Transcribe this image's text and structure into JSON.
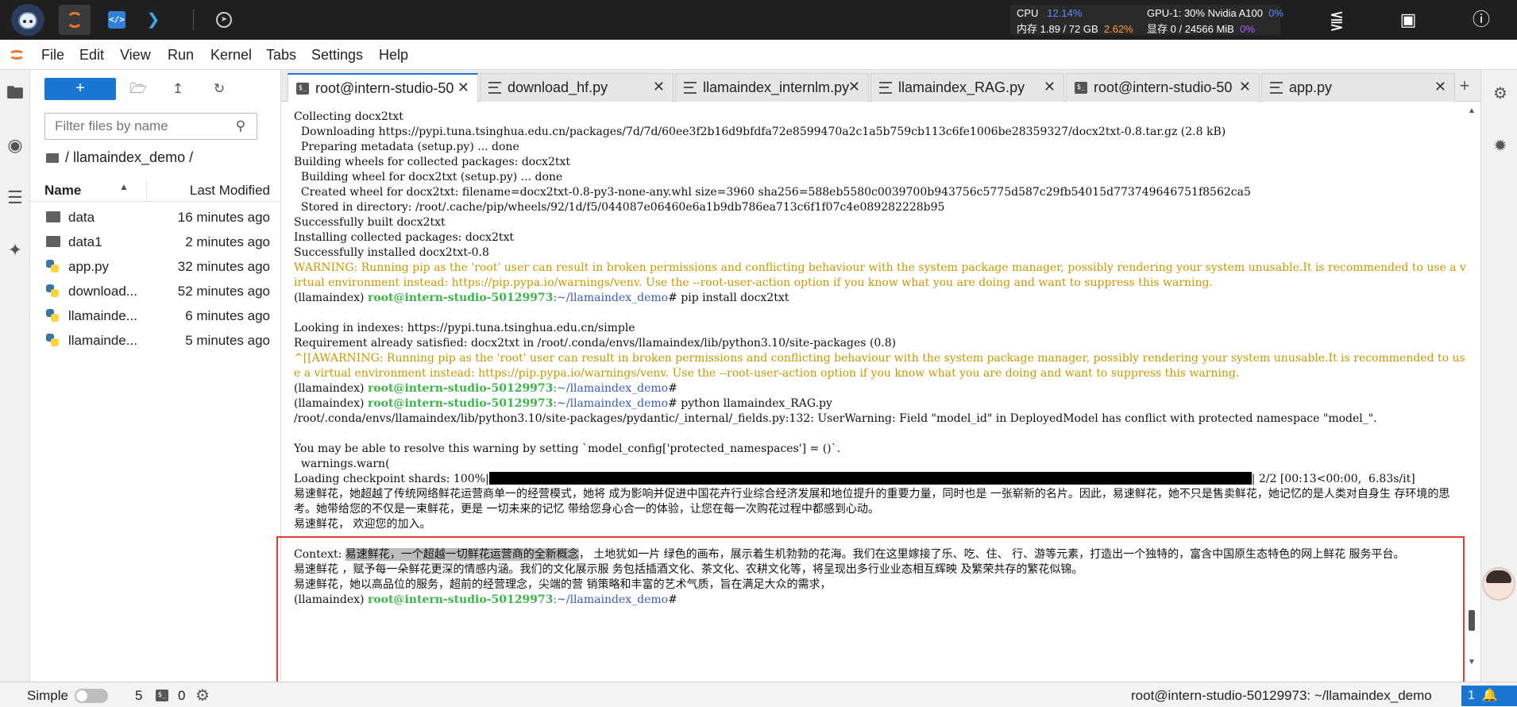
{
  "topbar": {
    "apps": [
      "intern-logo",
      "jupyter-icon",
      "code-icon",
      "vscode-icon",
      "compass-icon"
    ],
    "cpu_label": "CPU",
    "cpu_value": "12.14%",
    "mem_label": "内存",
    "mem_value": "1.89 / 72 GB",
    "mem_percent": "2.62%",
    "gpu_label": "GPU-1: 30% Nvidia A100",
    "gpu_percent": "0%",
    "vram_label": "显存",
    "vram_value": "0 / 24566 MiB",
    "vram_percent": "0%",
    "colors": {
      "blue": "#5c8dff",
      "orange": "#ff9d3a",
      "purple": "#b25cff"
    }
  },
  "menu": {
    "items": [
      "File",
      "Edit",
      "View",
      "Run",
      "Kernel",
      "Tabs",
      "Settings",
      "Help"
    ]
  },
  "filebrowser": {
    "new_label": "+",
    "search_placeholder": "Filter files by name",
    "breadcrumb": "/ llamaindex_demo /",
    "col_name": "Name",
    "col_modified": "Last Modified",
    "files": [
      {
        "name": "data",
        "type": "folder",
        "modified": "16 minutes ago"
      },
      {
        "name": "data1",
        "type": "folder",
        "modified": "2 minutes ago"
      },
      {
        "name": "app.py",
        "type": "python",
        "modified": "32 minutes ago"
      },
      {
        "name": "download...",
        "type": "python",
        "modified": "52 minutes ago"
      },
      {
        "name": "llamainde...",
        "type": "python",
        "modified": "6 minutes ago"
      },
      {
        "name": "llamainde...",
        "type": "python",
        "modified": "5 minutes ago"
      }
    ]
  },
  "tabs": [
    {
      "label": "root@intern-studio-50",
      "icon": "terminal",
      "active": true
    },
    {
      "label": "download_hf.py",
      "icon": "document",
      "active": false
    },
    {
      "label": "llamaindex_internlm.py",
      "icon": "document",
      "active": false
    },
    {
      "label": "llamaindex_RAG.py",
      "icon": "document",
      "active": false
    },
    {
      "label": "root@intern-studio-50",
      "icon": "terminal",
      "active": false
    },
    {
      "label": "app.py",
      "icon": "document",
      "active": false
    }
  ],
  "terminal": {
    "l01": "Collecting docx2txt",
    "l02": "  Downloading https://pypi.tuna.tsinghua.edu.cn/packages/7d/7d/60ee3f2b16d9bfdfa72e8599470a2c1a5b759cb113c6fe1006be28359327/docx2txt-0.8.tar.gz (2.8 kB)",
    "l03": "  Preparing metadata (setup.py) ... done",
    "l04": "Building wheels for collected packages: docx2txt",
    "l05": "  Building wheel for docx2txt (setup.py) ... done",
    "l06": "  Created wheel for docx2txt: filename=docx2txt-0.8-py3-none-any.whl size=3960 sha256=588eb5580c0039700b943756c5775d587c29fb54015d773749646751f8562ca5",
    "l07": "  Stored in directory: /root/.cache/pip/wheels/92/1d/f5/044087e06460e6a1b9db786ea713c6f1f07c4e089282228b95",
    "l08": "Successfully built docx2txt",
    "l09": "Installing collected packages: docx2txt",
    "l10": "Successfully installed docx2txt-0.8",
    "l11": "WARNING: Running pip as the 'root' user can result in broken permissions and conflicting behaviour with the system package manager, possibly rendering your system unusable.It is recommended to use a virtual environment instead: https://pip.pypa.io/warnings/venv. Use the --root-user-action option if you know what you are doing and want to suppress this warning.",
    "env": "(llamaindex) ",
    "user": "root@intern-studio-50129973",
    "path": ":~/llamaindex_demo",
    "cmd1": "# pip install docx2txt",
    "l13": "Looking in indexes: https://pypi.tuna.tsinghua.edu.cn/simple",
    "l14": "Requirement already satisfied: docx2txt in /root/.conda/envs/llamaindex/lib/python3.10/site-packages (0.8)",
    "l15": "^[[AWARNING: Running pip as the 'root' user can result in broken permissions and conflicting behaviour with the system package manager, possibly rendering your system unusable.It is recommended to use a virtual environment instead: https://pip.pypa.io/warnings/venv. Use the --root-user-action option if you know what you are doing and want to suppress this warning.",
    "cmd2": "#",
    "cmd3": "# python llamaindex_RAG.py",
    "l18": "/root/.conda/envs/llamaindex/lib/python3.10/site-packages/pydantic/_internal/_fields.py:132: UserWarning: Field \"model_id\" in DeployedModel has conflict with protected namespace \"model_\".",
    "l20": "You may be able to resolve this warning by setting `model_config['protected_namespaces'] = ()`.",
    "l21": "  warnings.warn(",
    "progress_prefix": "Loading checkpoint shards: 100%|",
    "progress_suffix": "| 2/2 [00:13<00:00,  6.83s/it]",
    "progress_value": 1.0,
    "ans1": "易速鲜花，她超越了传统网络鲜花运营商单一的经营模式，她将 成为影响并促进中国花卉行业综合经济发展和地位提升的重要力量，同时也是 一张崭新的名片。因此，易速鲜花，她不只是售卖鲜花，她记忆的是人类对自身生 存环境的思考。她带给您的不仅是一束鲜花，更是 一切未来的记忆 带给您身心合一的体验，让您在每一次购花过程中都感到心动。",
    "ans2": "易速鲜花， 欢迎您的加入。",
    "ctx_label": "Context: ",
    "ctx_hl": "易速鲜花，一个超越一切鲜花运营商的全新概念",
    "ctx_rest": "， 土地犹如一片 绿色的画布，展示着生机勃勃的花海。我们在这里嫁接了乐、吃、住、 行、游等元素，打造出一个独特的，富含中国原生态特色的网上鲜花 服务平台。",
    "ctx2": "易速鲜花 ，赋予每一朵鲜花更深的情感内涵。我们的文化展示服 务包括插酒文化、茶文化、农耕文化等，将呈现出多行业业态相互辉映 及繁荣共存的繁花似锦。",
    "ctx3": "易速鲜花，她以高品位的服务，超前的经营理念，尖端的营 销策略和丰富的艺术气质，旨在满足大众的需求，",
    "cmd_final": "#"
  },
  "statusbar": {
    "mode": "Simple",
    "count_terminals": "5",
    "count_kernels": "0",
    "location": "root@intern-studio-50129973: ~/llamaindex_demo",
    "notifications": "1"
  }
}
